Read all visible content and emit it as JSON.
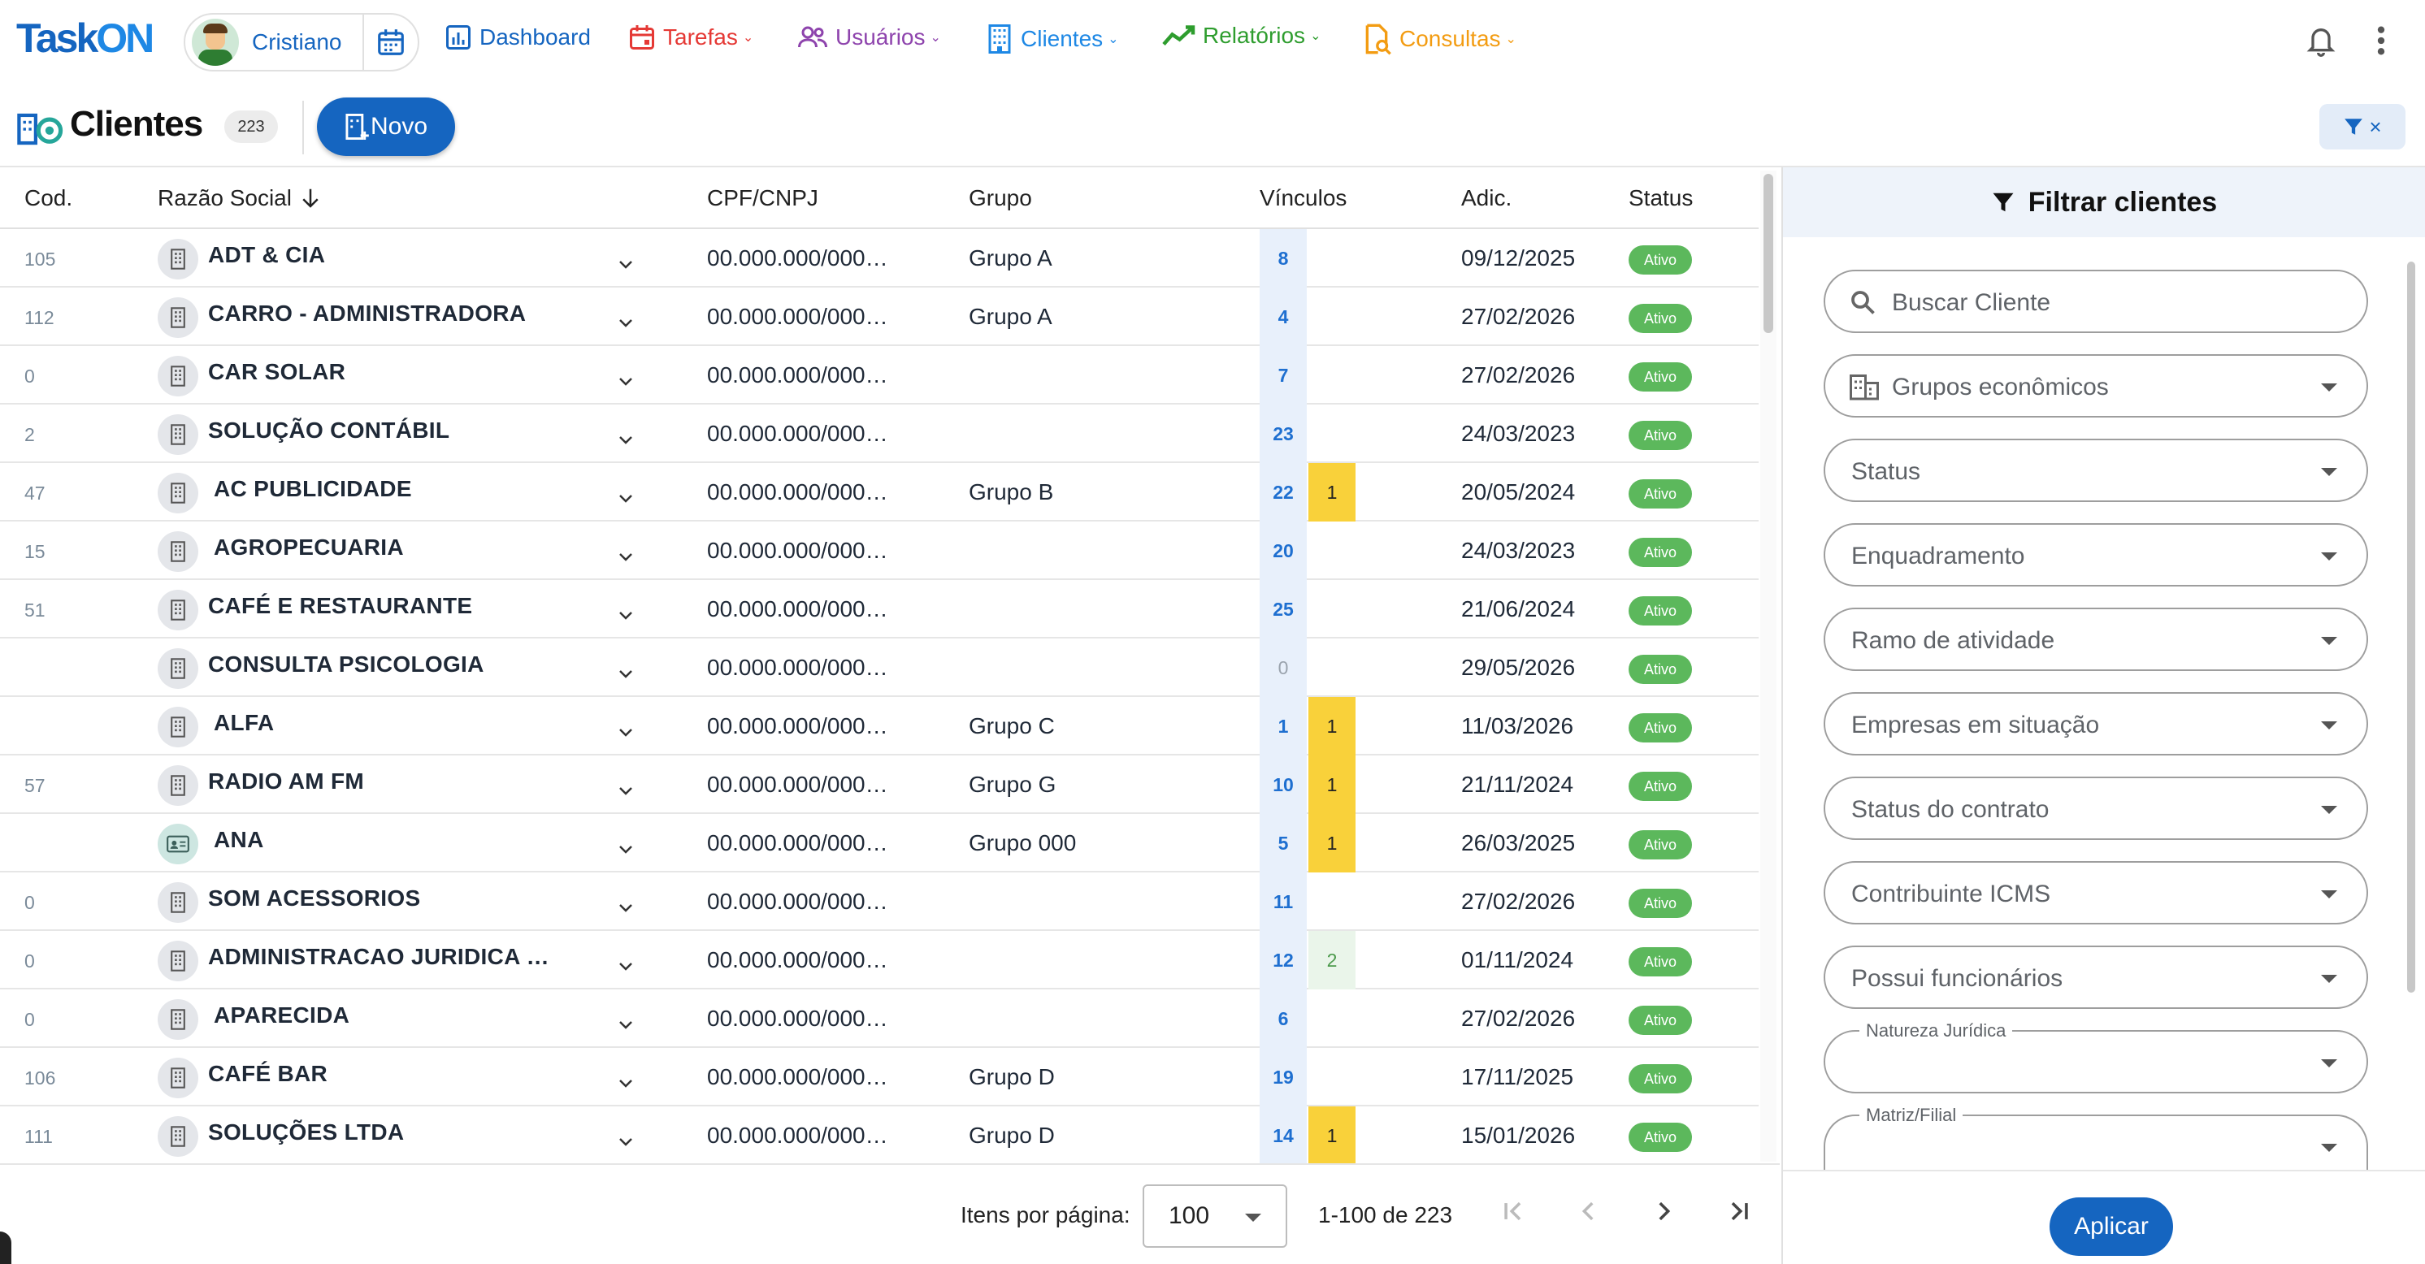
{
  "app": {
    "logo": "TaskOn",
    "logo_a": "Task",
    "logo_b": "ON",
    "user_name": "Cristiano"
  },
  "nav": [
    {
      "label": "Dashboard",
      "color": "#1565c0",
      "icon": "chart-icon",
      "chevron": false
    },
    {
      "label": "Tarefas",
      "color": "#e53935",
      "icon": "calendar-icon",
      "chevron": true
    },
    {
      "label": "Usuários",
      "color": "#8e44ad",
      "icon": "users-icon",
      "chevron": true
    },
    {
      "label": "Clientes",
      "color": "#1e88e5",
      "icon": "building-icon",
      "chevron": true
    },
    {
      "label": "Relatórios",
      "color": "#2e9d2e",
      "icon": "trend-icon",
      "chevron": true
    },
    {
      "label": "Consultas",
      "color": "#f39c12",
      "icon": "search-doc-icon",
      "chevron": true
    }
  ],
  "page": {
    "title": "Clientes",
    "count": "223",
    "new_label": "Novo"
  },
  "table": {
    "columns": {
      "cod": "Cod.",
      "razao": "Razão Social",
      "cpf": "CPF/CNPJ",
      "grupo": "Grupo",
      "vinculos": "Vínculos",
      "adic": "Adic.",
      "status": "Status"
    },
    "rows": [
      {
        "cod": "105",
        "name": "ADT & CIA",
        "cpf": "00.000.000/000…",
        "grupo": "Grupo A",
        "vin": "8",
        "vin2": "",
        "vin2_type": "",
        "date": "09/12/2025",
        "status": "Ativo",
        "icon": "building"
      },
      {
        "cod": "112",
        "name": "CARRO - ADMINISTRADORA",
        "cpf": "00.000.000/000…",
        "grupo": "Grupo A",
        "vin": "4",
        "vin2": "",
        "vin2_type": "",
        "date": "27/02/2026",
        "status": "Ativo",
        "icon": "building"
      },
      {
        "cod": "0",
        "name": "CAR SOLAR",
        "cpf": "00.000.000/000…",
        "grupo": "",
        "vin": "7",
        "vin2": "",
        "vin2_type": "",
        "date": "27/02/2026",
        "status": "Ativo",
        "icon": "building"
      },
      {
        "cod": "2",
        "name": "SOLUÇÃO CONTÁBIL",
        "cpf": "00.000.000/000…",
        "grupo": "",
        "vin": "23",
        "vin2": "",
        "vin2_type": "",
        "date": "24/03/2023",
        "status": "Ativo",
        "icon": "building"
      },
      {
        "cod": "47",
        "name": " AC PUBLICIDADE",
        "cpf": "00.000.000/000…",
        "grupo": "Grupo B",
        "vin": "22",
        "vin2": "1",
        "vin2_type": "yellow",
        "date": "20/05/2024",
        "status": "Ativo",
        "icon": "building"
      },
      {
        "cod": "15",
        "name": " AGROPECUARIA",
        "cpf": "00.000.000/000…",
        "grupo": "",
        "vin": "20",
        "vin2": "",
        "vin2_type": "",
        "date": "24/03/2023",
        "status": "Ativo",
        "icon": "building"
      },
      {
        "cod": "51",
        "name": "CAFÉ E RESTAURANTE",
        "cpf": "00.000.000/000…",
        "grupo": "",
        "vin": "25",
        "vin2": "",
        "vin2_type": "",
        "date": "21/06/2024",
        "status": "Ativo",
        "icon": "building"
      },
      {
        "cod": "",
        "name": "CONSULTA PSICOLOGIA",
        "cpf": "00.000.000/000…",
        "grupo": "",
        "vin": "0",
        "vin2": "",
        "vin2_type": "",
        "date": "29/05/2026",
        "status": "Ativo",
        "icon": "building"
      },
      {
        "cod": "",
        "name": " ALFA",
        "cpf": "00.000.000/000…",
        "grupo": "Grupo C",
        "vin": "1",
        "vin2": "1",
        "vin2_type": "yellow",
        "date": "11/03/2026",
        "status": "Ativo",
        "icon": "building"
      },
      {
        "cod": "57",
        "name": "RADIO AM FM",
        "cpf": "00.000.000/000…",
        "grupo": "Grupo G",
        "vin": "10",
        "vin2": "1",
        "vin2_type": "yellow",
        "date": "21/11/2024",
        "status": "Ativo",
        "icon": "building"
      },
      {
        "cod": "",
        "name": " ANA",
        "cpf": "00.000.000/000…",
        "grupo": "Grupo 000",
        "vin": "5",
        "vin2": "1",
        "vin2_type": "yellow",
        "date": "26/03/2025",
        "status": "Ativo",
        "icon": "person"
      },
      {
        "cod": "0",
        "name": "SOM ACESSORIOS",
        "cpf": "00.000.000/000…",
        "grupo": "",
        "vin": "11",
        "vin2": "",
        "vin2_type": "",
        "date": "27/02/2026",
        "status": "Ativo",
        "icon": "building"
      },
      {
        "cod": "0",
        "name": "ADMINISTRACAO JURIDICA …",
        "cpf": "00.000.000/000…",
        "grupo": "",
        "vin": "12",
        "vin2": "2",
        "vin2_type": "green",
        "date": "01/11/2024",
        "status": "Ativo",
        "icon": "building"
      },
      {
        "cod": "0",
        "name": " APARECIDA",
        "cpf": "00.000.000/000…",
        "grupo": "",
        "vin": "6",
        "vin2": "",
        "vin2_type": "",
        "date": "27/02/2026",
        "status": "Ativo",
        "icon": "building"
      },
      {
        "cod": "106",
        "name": "CAFÉ BAR",
        "cpf": "00.000.000/000…",
        "grupo": "Grupo D",
        "vin": "19",
        "vin2": "",
        "vin2_type": "",
        "date": "17/11/2025",
        "status": "Ativo",
        "icon": "building"
      },
      {
        "cod": "111",
        "name": "SOLUÇÕES LTDA",
        "cpf": "00.000.000/000…",
        "grupo": "Grupo D",
        "vin": "14",
        "vin2": "1",
        "vin2_type": "yellow",
        "date": "15/01/2026",
        "status": "Ativo",
        "icon": "building"
      }
    ]
  },
  "pagination": {
    "per_page_label": "Itens por página:",
    "per_page_value": "100",
    "range": "1-100 de 223"
  },
  "filter_panel": {
    "title": "Filtrar clientes",
    "fields": [
      {
        "label": "Buscar Cliente",
        "type": "search"
      },
      {
        "label": "Grupos econômicos",
        "type": "select-icon"
      },
      {
        "label": "Status",
        "type": "select"
      },
      {
        "label": "Enquadramento",
        "type": "select"
      },
      {
        "label": "Ramo de atividade",
        "type": "select"
      },
      {
        "label": "Empresas em situação",
        "type": "select"
      },
      {
        "label": "Status do contrato",
        "type": "select"
      },
      {
        "label": "Contribuinte ICMS",
        "type": "select"
      },
      {
        "label": "Possui funcionários",
        "type": "select"
      },
      {
        "label": "Natureza Jurídica",
        "type": "float"
      },
      {
        "label": "Matriz/Filial",
        "type": "float"
      }
    ],
    "apply_label": "Aplicar",
    "clear_symbol": "×"
  },
  "colors": {
    "primary": "#1565c0",
    "status_active": "#5cb85c",
    "badge_yellow": "#f9d13a",
    "vin_bg": "#e8f0fb"
  }
}
